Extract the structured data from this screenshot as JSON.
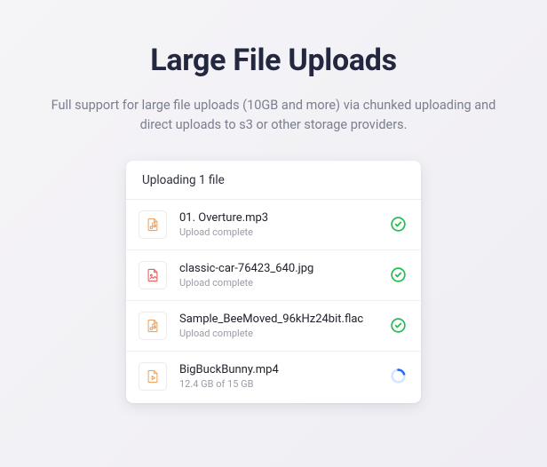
{
  "header": {
    "title": "Large File Uploads",
    "subtitle": "Full support for large file uploads (10GB and more) via chunked uploading and direct uploads to s3 or other storage providers."
  },
  "panel": {
    "title": "Uploading 1 file",
    "items": [
      {
        "icon": "audio",
        "name": "01. Overture.mp3",
        "status": "Upload complete",
        "state": "done"
      },
      {
        "icon": "image",
        "name": "classic-car-76423_640.jpg",
        "status": "Upload complete",
        "state": "done"
      },
      {
        "icon": "audio",
        "name": "Sample_BeeMoved_96kHz24bit.flac",
        "status": "Upload complete",
        "state": "done"
      },
      {
        "icon": "video",
        "name": "BigBuckBunny.mp4",
        "status": "12.4 GB of 15 GB",
        "state": "progress"
      }
    ]
  },
  "colors": {
    "accent_orange": "#f0a35f",
    "accent_red": "#ea5b5b",
    "success": "#1fbf4d",
    "progress": "#1f6dff"
  }
}
